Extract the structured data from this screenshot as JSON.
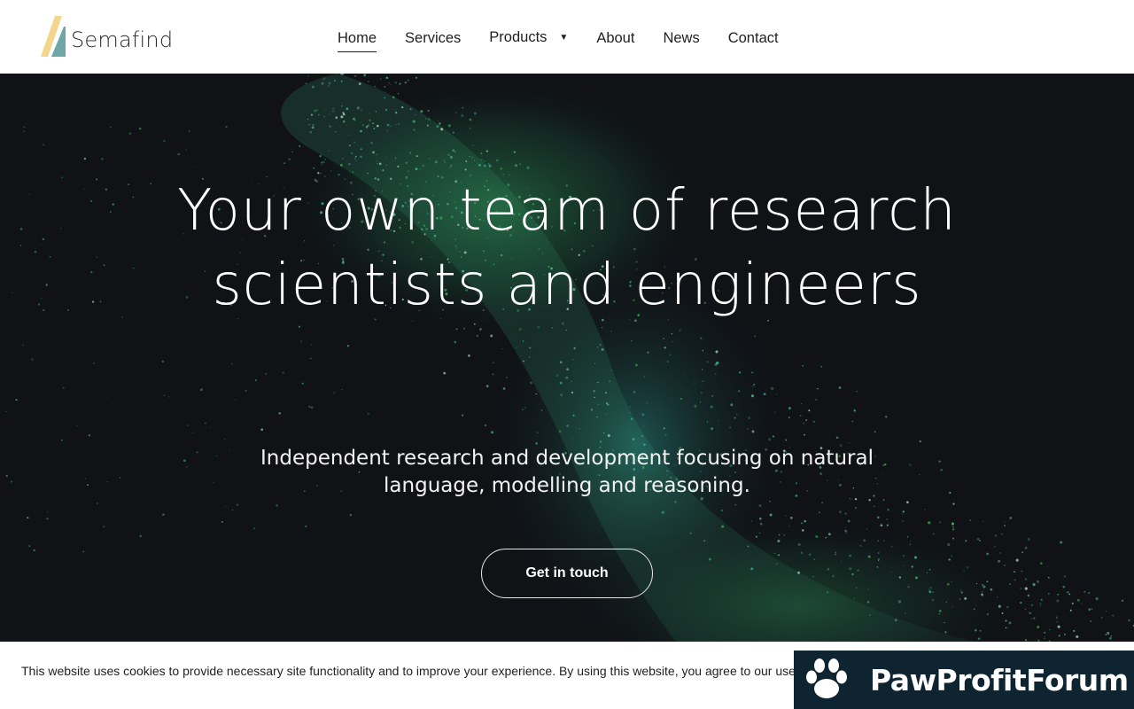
{
  "header": {
    "logo_text": "Semafind",
    "nav": [
      {
        "label": "Home",
        "active": true
      },
      {
        "label": "Services"
      },
      {
        "label": "Products",
        "has_dropdown": true
      },
      {
        "label": "About"
      },
      {
        "label": "News"
      },
      {
        "label": "Contact"
      }
    ]
  },
  "hero": {
    "title": "Your own team of research scientists and engineers",
    "subtitle": "Independent research and development focusing on natural language, modelling and reasoning.",
    "cta_label": "Get in touch"
  },
  "cookie_bar": {
    "text": "This website uses cookies to provide necessary site functionality and to improve your experience. By using this website, you agree to our use of cookies."
  },
  "watermark": {
    "text": "PawProfitForum"
  },
  "colors": {
    "hero_bg": "#101216",
    "particle_green": "#3fae5a",
    "particle_teal": "#37b3a2",
    "logo_yellow": "#f3d68c",
    "logo_teal": "#6fa6a8",
    "watermark_bg": "#0f2431"
  }
}
